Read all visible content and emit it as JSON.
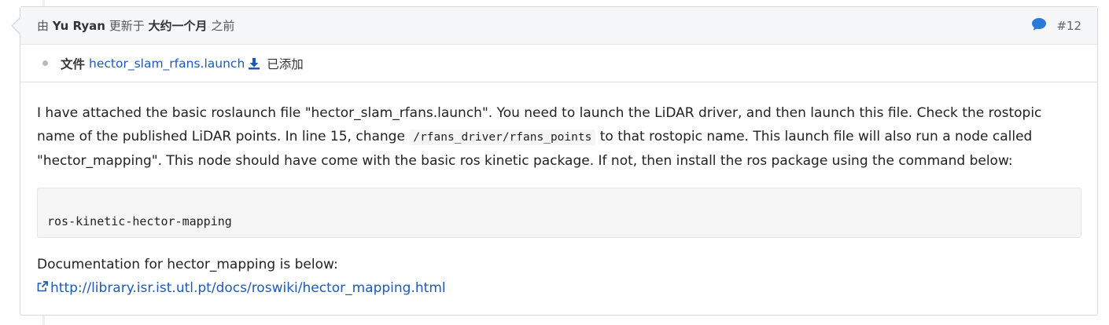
{
  "header": {
    "by_prefix": "由",
    "author": "Yu Ryan",
    "updated_prefix": "更新于",
    "updated_ago": "大约一个月",
    "updated_suffix": "之前",
    "note_number": "#12",
    "comment_icon": "comment-icon"
  },
  "details": {
    "label": "文件",
    "file_name": "hector_slam_rfans.launch",
    "download_icon": "download-icon",
    "status": "已添加"
  },
  "body": {
    "para1_a": "I have attached the basic roslaunch file \"hector_slam_rfans.launch\". You need to launch the LiDAR driver, and then launch this file. Check the rostopic name of the published LiDAR points. In line 15, change",
    "para1_code": "/rfans_driver/rfans_points",
    "para1_b": "to that rostopic name. This launch file will also run a node called \"hector_mapping\". This node should have come with the basic ros kinetic package. If not, then install the ros package using the command below:",
    "code_block": "ros-kinetic-hector-mapping",
    "para2": "Documentation for hector_mapping is below:",
    "link_url": "http://library.isr.ist.utl.pt/docs/roswiki/hector_mapping.html",
    "external_icon": "external-link-icon"
  },
  "colors": {
    "link": "#1d5ab8",
    "header_bg": "#f6f7f8",
    "comment_icon": "#2a7ad6"
  }
}
